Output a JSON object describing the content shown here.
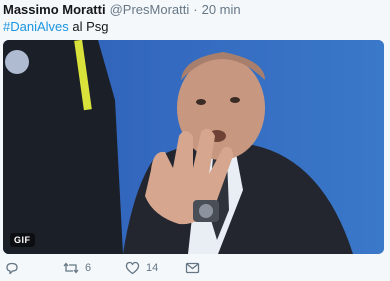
{
  "tweet": {
    "author": "Massimo Moratti",
    "handle": "@PresMoratti",
    "separator": "·",
    "time": "20 min",
    "hashtag": "#DaniAlves",
    "text_rest": " al Psg",
    "media_badge": "GIF"
  },
  "actions": {
    "retweets": "6",
    "likes": "14"
  },
  "icons": [
    "reply-icon",
    "retweet-icon",
    "like-icon",
    "message-icon"
  ],
  "colors": {
    "link": "#1b95e0",
    "muted": "#657786",
    "background": "#f5f8fa"
  }
}
